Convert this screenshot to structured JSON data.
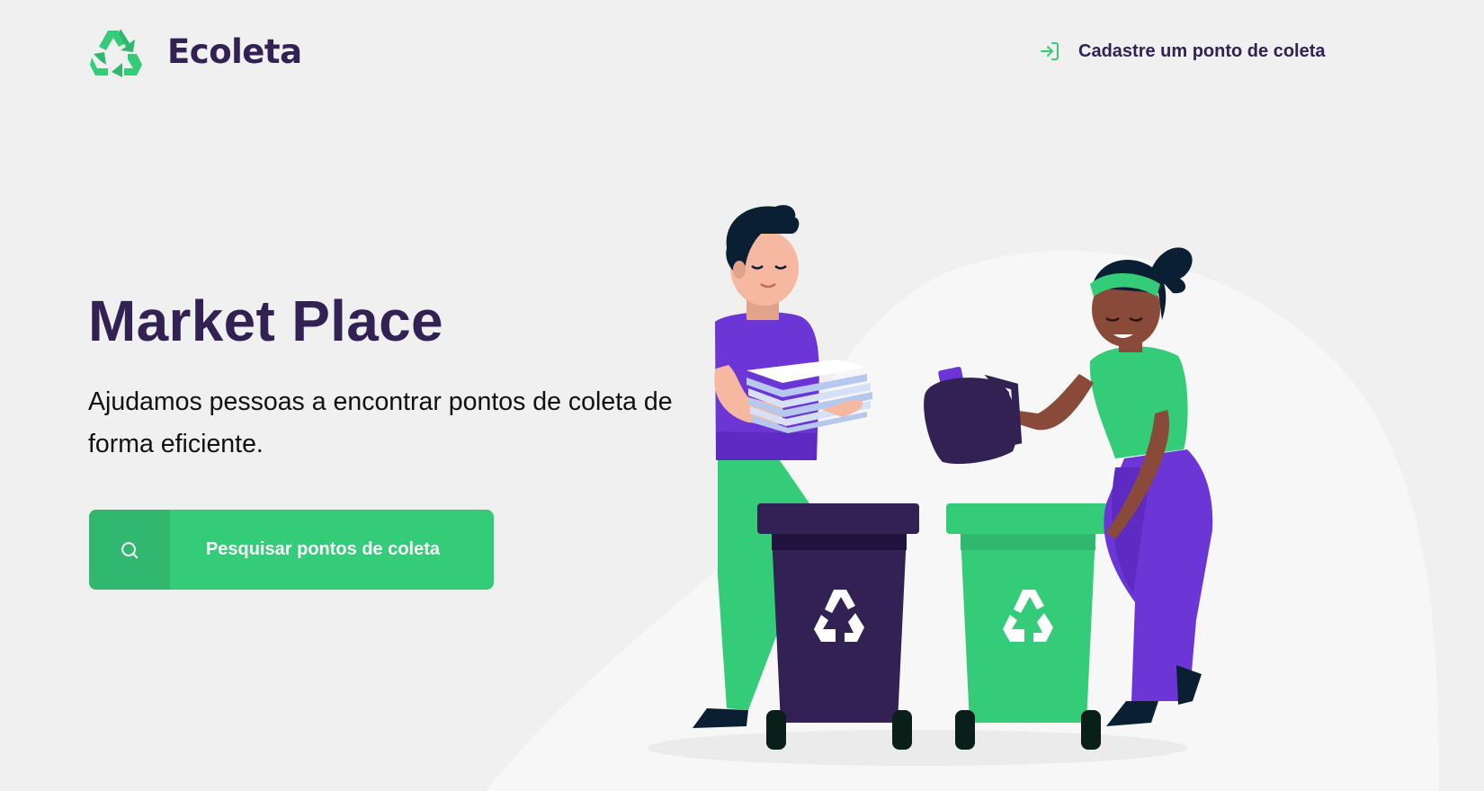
{
  "header": {
    "logo_text": "Ecoleta",
    "register_link_label": "Cadastre um ponto de coleta",
    "register_icon": "log-in-icon"
  },
  "hero": {
    "title": "Market Place",
    "description": "Ajudamos pessoas a encontrar pontos de coleta de forma eficiente.",
    "cta_label": "Pesquisar pontos de coleta",
    "cta_icon": "search-icon"
  },
  "colors": {
    "primary": "#34cb79",
    "primary_dark": "#2fb86e",
    "title": "#322153",
    "background": "#f0f0f0",
    "purple": "#6c36d6",
    "dark_bin": "#322153"
  }
}
